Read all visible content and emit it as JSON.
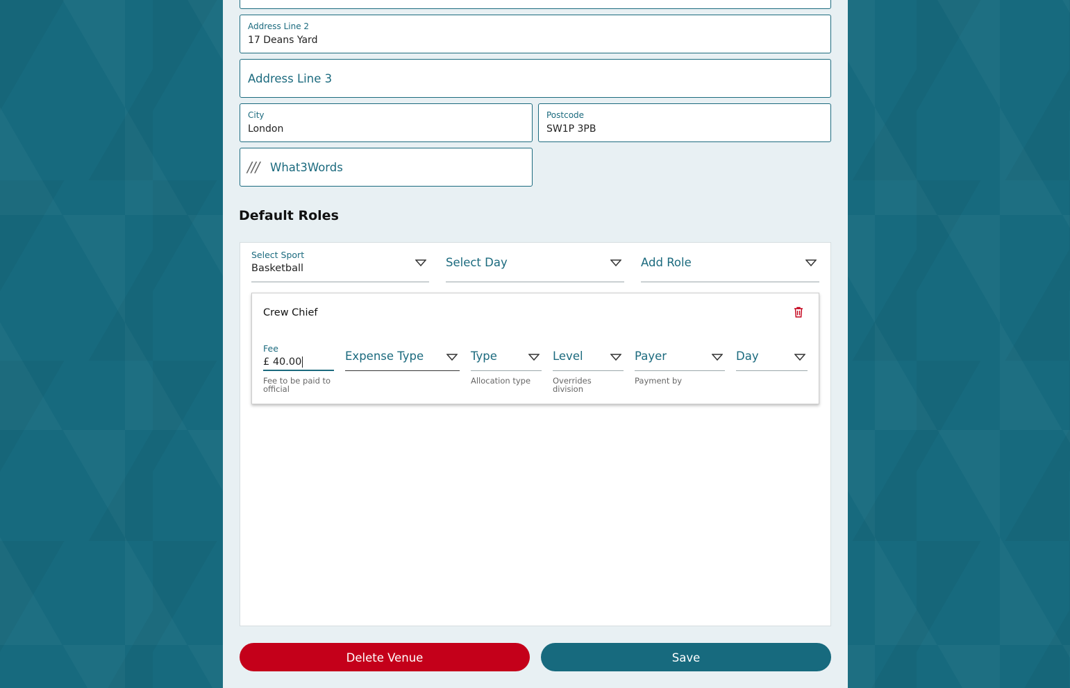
{
  "form": {
    "address_line_2": {
      "label": "Address Line 2",
      "value": "17 Deans Yard"
    },
    "address_line_3": {
      "placeholder": "Address Line 3"
    },
    "city": {
      "label": "City",
      "value": "London"
    },
    "postcode": {
      "label": "Postcode",
      "value": "SW1P 3PB"
    },
    "what3words": {
      "icon_text": "///",
      "placeholder": "What3Words"
    }
  },
  "default_roles": {
    "title": "Default Roles",
    "select_sport": {
      "label": "Select Sport",
      "value": "Basketball"
    },
    "select_day": {
      "placeholder": "Select Day"
    },
    "add_role": {
      "placeholder": "Add Role"
    },
    "role_card": {
      "title": "Crew Chief",
      "fee": {
        "label": "Fee",
        "value": "£ 40.00",
        "helper": "Fee to be paid to official"
      },
      "expense_type": {
        "placeholder": "Expense Type"
      },
      "type": {
        "placeholder": "Type",
        "helper": "Allocation type"
      },
      "level": {
        "placeholder": "Level",
        "helper": "Overrides division"
      },
      "payer": {
        "placeholder": "Payer",
        "helper": "Payment by"
      },
      "day": {
        "placeholder": "Day"
      }
    }
  },
  "actions": {
    "delete_label": "Delete Venue",
    "save_label": "Save"
  },
  "colors": {
    "background": "#176a7e",
    "accent": "#1b6a7e",
    "danger": "#c4001a",
    "panel": "#e8f0f3"
  }
}
